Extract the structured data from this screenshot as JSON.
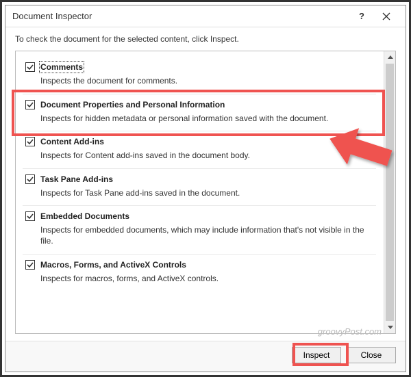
{
  "titlebar": {
    "title": "Document Inspector",
    "help_label": "?",
    "close_label": "✕"
  },
  "instruction": "To check the document for the selected content, click Inspect.",
  "items": [
    {
      "title": "Comments",
      "desc": "Inspects the document for comments.",
      "checked": true,
      "focused": true
    },
    {
      "title": "Document Properties and Personal Information",
      "desc": "Inspects for hidden metadata or personal information saved with the document.",
      "checked": true,
      "focused": false
    },
    {
      "title": "Content Add-ins",
      "desc": "Inspects for Content add-ins saved in the document body.",
      "checked": true,
      "focused": false
    },
    {
      "title": "Task Pane Add-ins",
      "desc": "Inspects for Task Pane add-ins saved in the document.",
      "checked": true,
      "focused": false
    },
    {
      "title": "Embedded Documents",
      "desc": "Inspects for embedded documents, which may include information that's not visible in the file.",
      "checked": true,
      "focused": false
    },
    {
      "title": "Macros, Forms, and ActiveX Controls",
      "desc": "Inspects for macros, forms, and ActiveX controls.",
      "checked": true,
      "focused": false
    }
  ],
  "buttons": {
    "inspect": "Inspect",
    "close": "Close"
  },
  "watermark": "groovyPost.com"
}
